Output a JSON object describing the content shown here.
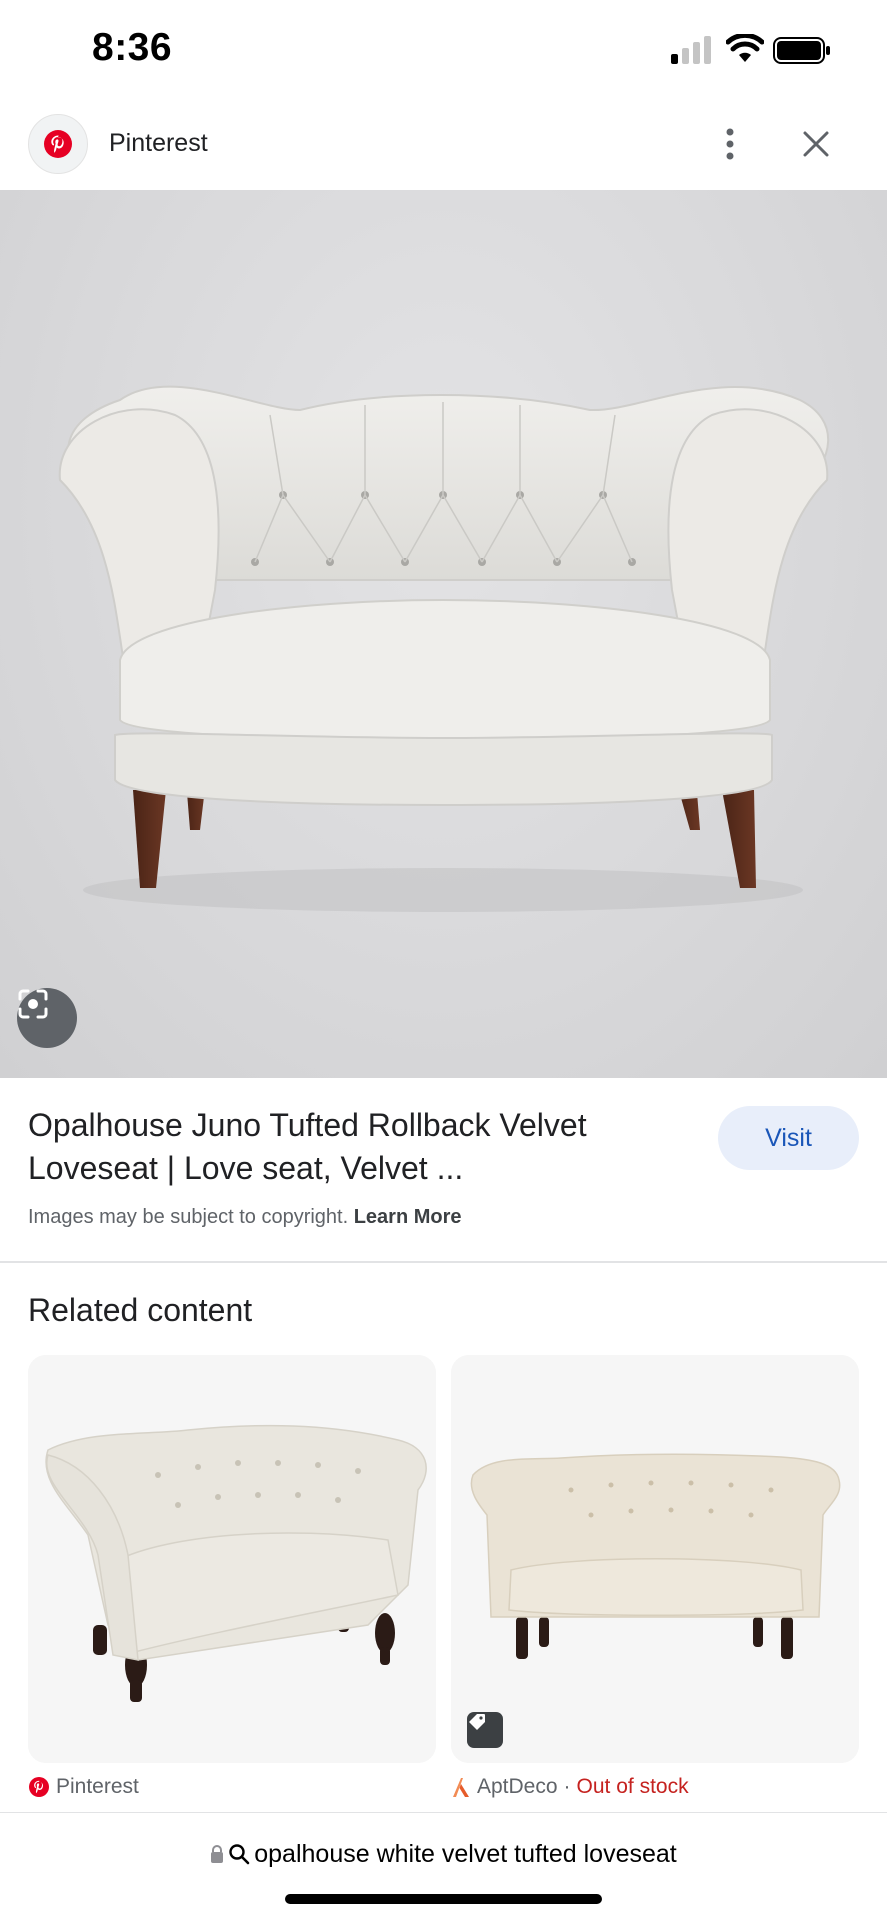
{
  "status_bar": {
    "time": "8:36"
  },
  "header": {
    "site_name": "Pinterest",
    "logo_icon": "pinterest-logo-icon",
    "more_icon": "more-vertical-icon",
    "close_icon": "close-icon"
  },
  "result": {
    "title_line1": "Opalhouse Juno Tufted Rollback Velvet",
    "title_line2": "Loveseat | Love seat, Velvet ...",
    "visit_label": "Visit",
    "copyright_text": "Images may be subject to copyright.",
    "learn_more": "Learn More"
  },
  "related": {
    "heading": "Related content",
    "items": [
      {
        "source": "Pinterest",
        "source_icon": "pinterest-logo-icon"
      },
      {
        "source": "AptDeco",
        "separator": "·",
        "status": "Out of stock",
        "source_icon": "aptdeco-logo-icon",
        "badge_icon": "price-tag-icon"
      }
    ]
  },
  "url_bar": {
    "query": "opalhouse white velvet tufted loveseat",
    "lock_icon": "lock-icon",
    "search_icon": "search-icon"
  },
  "colors": {
    "accent_blue": "#1a56b8",
    "visit_bg": "#e8eefa",
    "pinterest_red": "#e60023",
    "out_of_stock_red": "#c5221f"
  }
}
